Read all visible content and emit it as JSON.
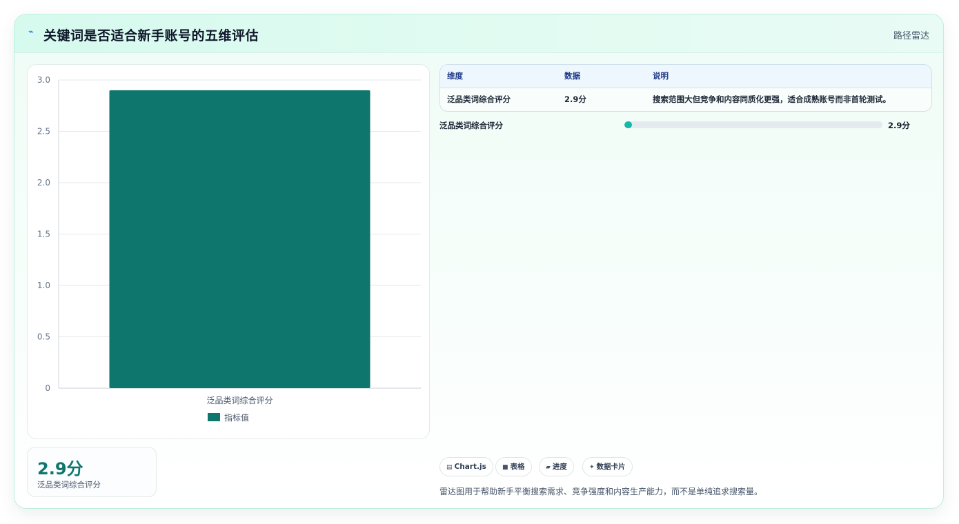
{
  "header": {
    "icon": "lightning-icon",
    "title": "关键词是否适合新手账号的五维评估",
    "tag": "路径雷达"
  },
  "chart_data": {
    "type": "bar",
    "categories": [
      "泛品类词综合评分"
    ],
    "series": [
      {
        "name": "指标值",
        "values": [
          2.9
        ],
        "color": "#0f766e"
      }
    ],
    "title": "",
    "xlabel": "",
    "ylabel": "",
    "ylim": [
      0,
      3
    ],
    "yticks": [
      "3.0",
      "2.5",
      "2.0",
      "1.5",
      "1.0",
      "0.5",
      "0"
    ],
    "grid": true,
    "legend": "bottom"
  },
  "stat": {
    "value": "2.9分",
    "label": "泛品类词综合评分"
  },
  "table": {
    "headers": [
      "维度",
      "数据",
      "说明"
    ],
    "rows": [
      [
        "泛品类词综合评分",
        "2.9分",
        "搜索范围大但竞争和内容同质化更强，适合成熟账号而非首轮测试。"
      ]
    ]
  },
  "progress": {
    "label": "泛品类词综合评分",
    "value_text": "2.9分",
    "fraction": 0.029
  },
  "chips": [
    {
      "icon": "chart-icon",
      "glyph": "▤",
      "label": "Chart.js"
    },
    {
      "icon": "table-icon",
      "glyph": "■",
      "label": "表格"
    },
    {
      "icon": "progress-icon",
      "glyph": "▰",
      "label": "进度"
    },
    {
      "icon": "sparkle-icon",
      "glyph": "✦",
      "label": "数据卡片"
    }
  ],
  "note": "雷达图用于帮助新手平衡搜索需求、竞争强度和内容生产能力，而不是单纯追求搜索量。"
}
